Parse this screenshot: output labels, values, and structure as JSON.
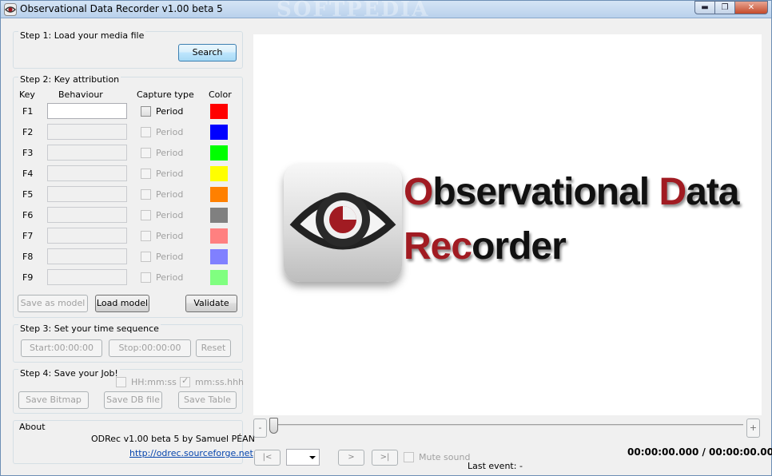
{
  "window": {
    "title": "Observational Data Recorder v1.00 beta 5",
    "watermark": "SOFTPEDIA",
    "buttons": {
      "minimize": "▬",
      "maximize": "❐",
      "close": "✕"
    }
  },
  "step1": {
    "label": "Step 1: Load your media file",
    "search_button": "Search"
  },
  "step2": {
    "label": "Step 2: Key attribution",
    "headers": {
      "key": "Key",
      "behaviour": "Behaviour",
      "capture_type": "Capture type",
      "color": "Color"
    },
    "period_label": "Period",
    "rows": [
      {
        "key": "F1",
        "color": "#ff0000",
        "enabled": true
      },
      {
        "key": "F2",
        "color": "#0000ff",
        "enabled": false
      },
      {
        "key": "F3",
        "color": "#00ff00",
        "enabled": false
      },
      {
        "key": "F4",
        "color": "#ffff00",
        "enabled": false
      },
      {
        "key": "F5",
        "color": "#ff8000",
        "enabled": false
      },
      {
        "key": "F6",
        "color": "#808080",
        "enabled": false
      },
      {
        "key": "F7",
        "color": "#ff8080",
        "enabled": false
      },
      {
        "key": "F8",
        "color": "#8080ff",
        "enabled": false
      },
      {
        "key": "F9",
        "color": "#80ff80",
        "enabled": false
      }
    ],
    "save_model": "Save as model",
    "load_model": "Load model",
    "validate": "Validate"
  },
  "step3": {
    "label": "Step 3: Set your time sequence",
    "start": "Start:00:00:00",
    "stop": "Stop:00:00:00",
    "reset": "Reset"
  },
  "step4": {
    "label": "Step 4: Save your Job!",
    "hh_format": "HH:mm:ss",
    "mm_format": "mm:ss.hhh",
    "save_bitmap": "Save Bitmap",
    "save_db": "Save DB file",
    "save_table": "Save Table"
  },
  "about": {
    "label": "About",
    "credit": "ODRec v1.00 beta 5 by Samuel PÉAN",
    "link": "http://odrec.sourceforge.net"
  },
  "logo": {
    "line1_first": "O",
    "line1_rest_a": "bservational ",
    "line1_d": "D",
    "line1_rest_b": "ata",
    "line2_first": "Rec",
    "line2_rest": "order"
  },
  "player": {
    "minus": "-",
    "plus": "+",
    "prev": "|<",
    "next": ">",
    "last": ">|",
    "mute_label": "Mute sound",
    "timer": "00:00:00.000 / 00:00:00.000",
    "last_event_label": "Last event:",
    "last_event_value": "-"
  },
  "colors": {
    "accent_red": "#a11b22"
  }
}
